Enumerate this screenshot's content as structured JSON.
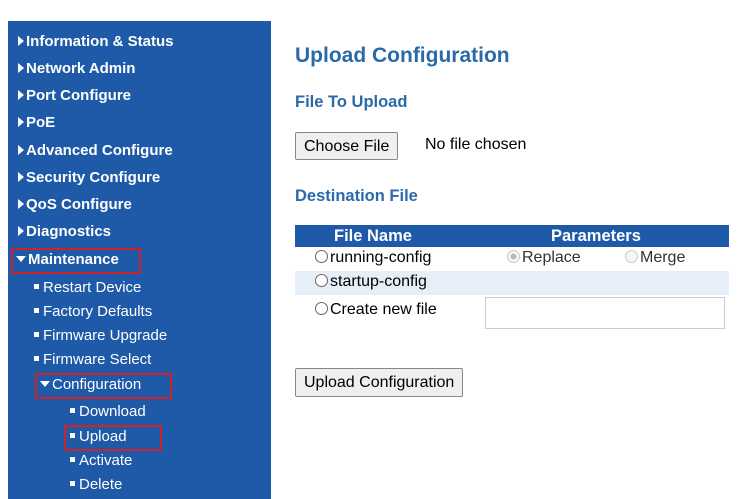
{
  "sidebar": {
    "items": [
      {
        "label": "Information & Status"
      },
      {
        "label": "Network Admin"
      },
      {
        "label": "Port Configure"
      },
      {
        "label": "PoE"
      },
      {
        "label": "Advanced Configure"
      },
      {
        "label": "Security Configure"
      },
      {
        "label": "QoS Configure"
      },
      {
        "label": "Diagnostics"
      },
      {
        "label": "Maintenance"
      }
    ],
    "maintenance_children": [
      {
        "label": "Restart Device"
      },
      {
        "label": "Factory Defaults"
      },
      {
        "label": "Firmware Upgrade"
      },
      {
        "label": "Firmware Select"
      },
      {
        "label": "Configuration"
      }
    ],
    "configuration_children": [
      {
        "label": "Download"
      },
      {
        "label": "Upload"
      },
      {
        "label": "Activate"
      },
      {
        "label": "Delete"
      }
    ]
  },
  "main": {
    "title": "Upload Configuration",
    "file_section_title": "File To Upload",
    "choose_file_label": "Choose File",
    "no_file_text": "No file chosen",
    "destination_title": "Destination File",
    "table": {
      "headers": [
        "File Name",
        "Parameters"
      ],
      "rows": [
        {
          "file": "running-config",
          "param1": "Replace",
          "param2": "Merge"
        },
        {
          "file": "startup-config"
        },
        {
          "file": "Create new file",
          "input_value": ""
        }
      ]
    },
    "upload_button_label": "Upload Configuration"
  },
  "colors": {
    "sidebar": "#1f5aa8",
    "heading": "#2a6aab",
    "highlight": "#d0202a"
  }
}
